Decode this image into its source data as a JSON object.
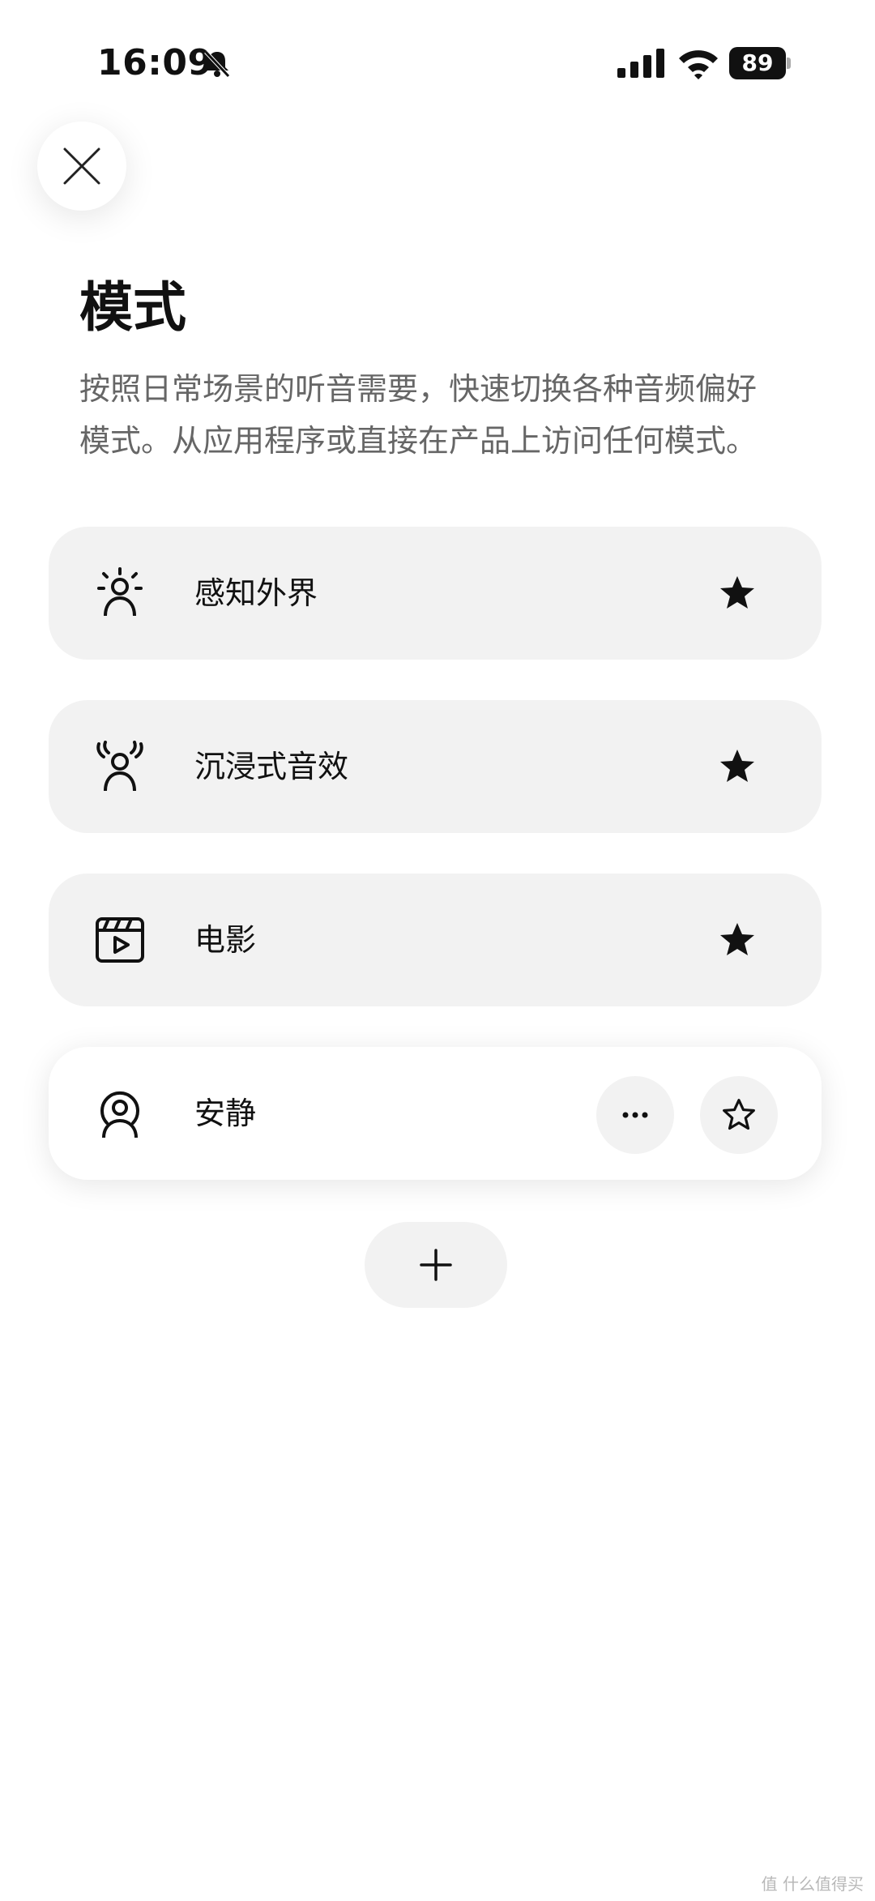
{
  "status_bar": {
    "time": "16:09",
    "battery_level": "89",
    "icons": [
      "bell-slash-icon",
      "signal-icon",
      "wifi-icon",
      "battery-icon"
    ]
  },
  "header": {
    "close_icon": "close-icon",
    "title": "模式",
    "description_line1": "按照日常场景的听音需要，快速切换各种音频偏好",
    "description_line2": "模式。从应用程序或直接在产品上访问任何模式。"
  },
  "modes": [
    {
      "label": "感知外界",
      "icon": "aware-icon",
      "favorite": true
    },
    {
      "label": "沉浸式音效",
      "icon": "immersive-icon",
      "favorite": true
    },
    {
      "label": "电影",
      "icon": "cinema-icon",
      "favorite": true
    },
    {
      "label": "安静",
      "icon": "quiet-icon",
      "favorite": false,
      "selected": true
    }
  ],
  "actions": {
    "more_icon": "more-icon",
    "add_icon": "plus-icon"
  },
  "watermark": "值 什么值得买"
}
